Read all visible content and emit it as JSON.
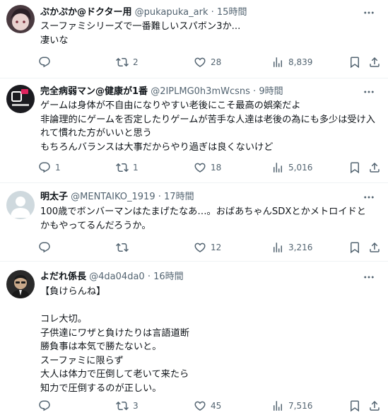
{
  "tweets": [
    {
      "name": "ぷかぷか@ドクター用",
      "handle": "@pukapuka_ark",
      "time": "15時間",
      "body": "スーファミシリーズで一番難しいスパボン3か...\n凄いな",
      "replies": "",
      "retweets": "2",
      "likes": "28",
      "views": "8,839"
    },
    {
      "name": "完全病弱マン@健康が1番",
      "handle": "@2IPLMG0h3mWcsns",
      "time": "9時間",
      "body": "ゲームは身体が不自由になりやすい老後にこそ最高の娯楽だよ\n非論理的にゲームを否定したりゲームが苦手な人達は老後の為にも多少は受け入れて慣れた方がいいと思う\nもちろんバランスは大事だからやり過ぎは良くないけど",
      "replies": "1",
      "retweets": "1",
      "likes": "18",
      "views": "5,016"
    },
    {
      "name": "明太子",
      "handle": "@MENTAIKO_1919",
      "time": "17時間",
      "body": "100歳でボンバーマンはたまげたなあ…。おばあちゃんSDXとかメトロイドとかもやってるんだろうか。",
      "replies": "",
      "retweets": "",
      "likes": "12",
      "views": "3,216"
    },
    {
      "name": "よだれ係長",
      "handle": "@4da04da0",
      "time": "16時間",
      "body": "【負けらんね】\n\nコレ大切。\n子供達にワザと負けたりは言語道断\n勝負事は本気で勝たないと。\nスーファミに限らず\n大人は体力で圧倒して老いて来たら\n知力で圧倒するのが正しい。",
      "replies": "",
      "retweets": "3",
      "likes": "45",
      "views": "7,516"
    }
  ],
  "dot": "·",
  "icons": {
    "reply": "reply-icon",
    "retweet": "retweet-icon",
    "like": "heart-icon",
    "views": "views-icon",
    "bookmark": "bookmark-icon",
    "share": "share-icon",
    "more": "more-icon"
  },
  "colors": {
    "text": "#0f1419",
    "muted": "#536471",
    "divider": "#eff3f4"
  }
}
